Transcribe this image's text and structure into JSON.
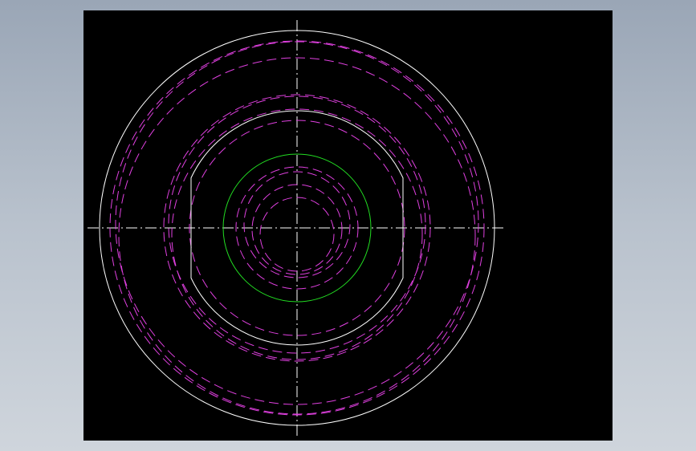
{
  "colors": {
    "background": "#000000",
    "outline": "#ffffff",
    "hidden": "#e040e0",
    "green": "#22dd22",
    "centerline": "#ffffff"
  }
}
